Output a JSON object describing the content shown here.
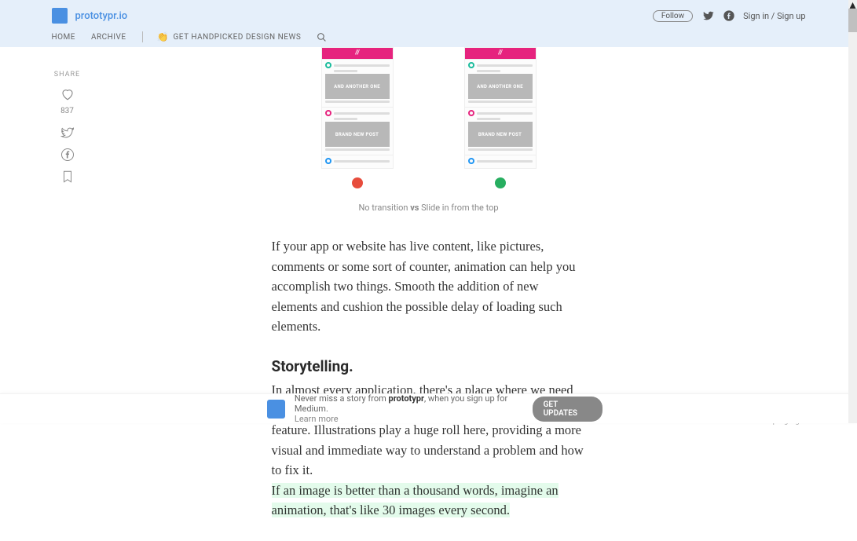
{
  "header": {
    "brand": "prototypr.io",
    "follow": "Follow",
    "signin": "Sign in / Sign up",
    "nav": {
      "home": "HOME",
      "archive": "ARCHIVE",
      "news": "GET HANDPICKED DESIGN NEWS"
    }
  },
  "share": {
    "label": "SHARE",
    "count": "837"
  },
  "figure": {
    "post1": "AND ANOTHER ONE",
    "post2": "BRAND NEW POST",
    "caption_left": "No transition",
    "caption_vs": "vs",
    "caption_right": " Slide in from the top"
  },
  "article": {
    "p1": "If your app or website has live content, like pictures, comments or some sort of counter, animation can help you accomplish two things. Smooth the addition of new elements and cushion the possible delay of loading such elements.",
    "h3": "Storytelling.",
    "p2": "In almost every application, there's a place where we need to explain something that went wrong or introduce a new feature. Illustrations play a huge roll here, providing a more visual and immediate way to understand a problem and how to fix it.",
    "p3": "If an image is better than a thousand words, imagine an animation, that's like 30 images every second."
  },
  "side": {
    "top_highlight": "Top highlight"
  },
  "footer": {
    "text1": "Never miss a story from ",
    "brand": "prototypr",
    "text2": ", when you sign up for Medium.",
    "learn": "Learn more",
    "button": "GET UPDATES"
  }
}
